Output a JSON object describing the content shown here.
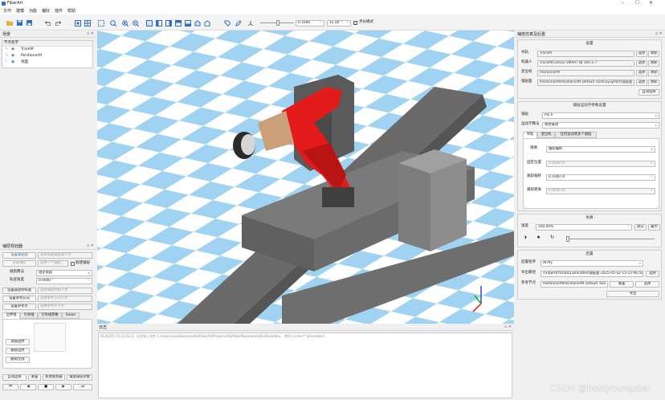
{
  "app": {
    "title": "FiberArt"
  },
  "menu": [
    "文件",
    "建模",
    "功能",
    "偏好",
    "插件",
    "帮助"
  ],
  "toolbar": {
    "slider_value": "0.1000",
    "angle_value": "15.00 °",
    "step_mode_label": "步长模式"
  },
  "scene_tree": {
    "title": "场景",
    "column": "节点名字",
    "items": [
      "TrackM",
      "PositionerM",
      "地面"
    ]
  },
  "layup_planner": {
    "title": "铺层规划器",
    "set_layup_label": "设置铺层面",
    "set_layup_field": "选择设置铺层面节点",
    "set_fill_label": "设置填区",
    "set_fill_field": "选择一个铺层...",
    "new_layup_label": "新建铺层",
    "rule_label": "规则算法",
    "rule_value": "固定角度",
    "angle_label": "轨迹角度",
    "angle_value": "0.0000 °",
    "ref_label": "设置铺放参照面",
    "ref_field": "选择铺放参照节点",
    "dir_label": "设置参考方向",
    "dir_field": "选择参考方向节点",
    "point_label": "设置参考点",
    "point_field": "选择参考点节点",
    "tabs": [
      "边界线",
      "引导线",
      "引导线参数",
      "Seam"
    ],
    "actions": [
      "添加边界",
      "删除边界",
      "删除全部"
    ],
    "bottom": [
      "自动选择",
      "重置",
      "新建规划器",
      "铺放铺层参数"
    ]
  },
  "log": {
    "title": "日志",
    "line": "01/02/25 15:11:52.3 : 正在导入文件 C:/Users/xxxx/Documents/FiberArt/Projects/HQ/FiberPlacementHQ.afxcombin... 完毕 [ccma (*.afxcombin)"
  },
  "sim": {
    "title": "铺放仿真及后置",
    "setup": {
      "title": "设置",
      "rows": [
        {
          "label": "导轨",
          "value": "TrackM"
        },
        {
          "label": "机器人",
          "value": "TrackM/Comau SMART NJ 500-2.7"
        },
        {
          "label": "变位机",
          "value": "PositionerM"
        },
        {
          "label": "铺层面",
          "value": "PositionerM/PositionerM Default Tool/LayupPart/铺层面"
        }
      ],
      "select": "选择",
      "clear": "清除",
      "auto": "自动选择"
    },
    "motion": {
      "title": "铺层运动学参数设置",
      "ply_label": "铺层",
      "ply_value": "Ply 0",
      "algo_label": "运动学算法",
      "algo_value": "线性联动",
      "tabs": [
        "导轨",
        "变位机",
        "任何运动到多个铺层"
      ],
      "strategy_label": "策略",
      "strategy_value": "跟踪偏移",
      "fixed_label": "固定位置",
      "fixed_value": "0.0000 m",
      "offset_label": "跟踪偏移",
      "offset_value": "0.1000 m",
      "dist_label": "跟踪距离",
      "dist_value": "0.0000 m"
    },
    "simulation": {
      "title": "仿真",
      "speed_label": "速度",
      "speed_value": "100.00%",
      "default_btn": "默认",
      "max_btn": "最大"
    },
    "post": {
      "title": "后置",
      "proc_label": "后置程序",
      "proc_value": "AFPly",
      "path_label": "导出路径",
      "path_value": "s\\FiberArt\\Data\\Laminates\\铺层面-2025-01-02-15-12-06.nc",
      "ref_label": "参考节点",
      "ref_value": "PositionerM/PositionerM Default Tool",
      "select": "选择",
      "reset": "重置",
      "export": "导出"
    }
  },
  "watermark": "CSDN @boldyoungster"
}
